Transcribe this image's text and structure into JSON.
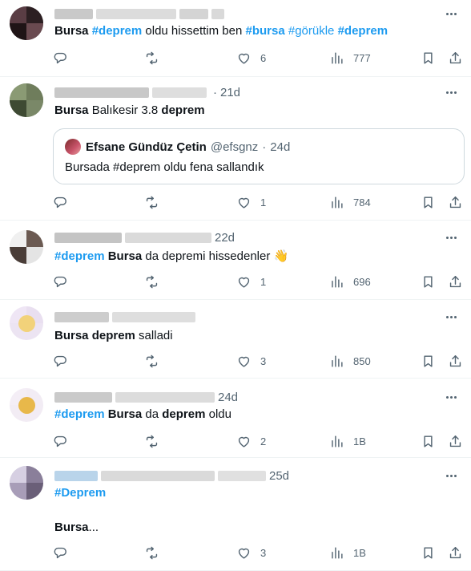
{
  "tweets": [
    {
      "time": "",
      "segments": [
        {
          "t": "Bursa",
          "b": true,
          "tag": false
        },
        {
          "t": " ",
          "b": false,
          "tag": false
        },
        {
          "t": "#deprem",
          "b": true,
          "tag": true
        },
        {
          "t": " oldu hissettim ben ",
          "b": false,
          "tag": false
        },
        {
          "t": "#bursa",
          "b": true,
          "tag": true
        },
        {
          "t": " ",
          "b": false,
          "tag": false
        },
        {
          "t": "#görükle",
          "b": false,
          "tag": true
        },
        {
          "t": " ",
          "b": false,
          "tag": false
        },
        {
          "t": "#deprem",
          "b": true,
          "tag": true
        }
      ],
      "replies": "",
      "retweets": "",
      "likes": "6",
      "views": "777"
    },
    {
      "time": "21d",
      "segments": [
        {
          "t": "Bursa",
          "b": true,
          "tag": false
        },
        {
          "t": " Balıkesir 3.8 ",
          "b": false,
          "tag": false
        },
        {
          "t": "deprem",
          "b": true,
          "tag": false
        }
      ],
      "quote": {
        "name": "Efsane Gündüz Çetin",
        "handle": "@efsgnz",
        "time": "24d",
        "text": "Bursada #deprem oldu fena sallandık"
      },
      "replies": "",
      "retweets": "",
      "likes": "1",
      "views": "784"
    },
    {
      "time": "22d",
      "segments": [
        {
          "t": "#deprem",
          "b": true,
          "tag": true
        },
        {
          "t": " ",
          "b": false,
          "tag": false
        },
        {
          "t": "Bursa",
          "b": true,
          "tag": false
        },
        {
          "t": " da depremi hissedenler ",
          "b": false,
          "tag": false
        },
        {
          "t": "👋",
          "b": false,
          "tag": false
        }
      ],
      "replies": "",
      "retweets": "",
      "likes": "1",
      "views": "696"
    },
    {
      "time": "",
      "segments": [
        {
          "t": "Bursa",
          "b": true,
          "tag": false
        },
        {
          "t": " ",
          "b": false,
          "tag": false
        },
        {
          "t": "deprem",
          "b": true,
          "tag": false
        },
        {
          "t": " salladi",
          "b": false,
          "tag": false
        }
      ],
      "replies": "",
      "retweets": "",
      "likes": "3",
      "views": "850"
    },
    {
      "time": "24d",
      "segments": [
        {
          "t": "#deprem",
          "b": true,
          "tag": true
        },
        {
          "t": " ",
          "b": false,
          "tag": false
        },
        {
          "t": "Bursa",
          "b": true,
          "tag": false
        },
        {
          "t": " da ",
          "b": false,
          "tag": false
        },
        {
          "t": "deprem",
          "b": true,
          "tag": false
        },
        {
          "t": " oldu",
          "b": false,
          "tag": false
        }
      ],
      "replies": "",
      "retweets": "",
      "likes": "2",
      "views": "1B"
    },
    {
      "time": "25d",
      "segments": [
        {
          "t": "#Deprem",
          "b": true,
          "tag": true
        }
      ],
      "segments2": [
        {
          "t": "Bursa",
          "b": true,
          "tag": false
        },
        {
          "t": "...",
          "b": false,
          "tag": false
        }
      ],
      "replies": "",
      "retweets": "",
      "likes": "3",
      "views": "1B"
    }
  ],
  "colors": {
    "accent": "#1d9bf0",
    "muted": "#536471",
    "border": "#eff3f4"
  }
}
